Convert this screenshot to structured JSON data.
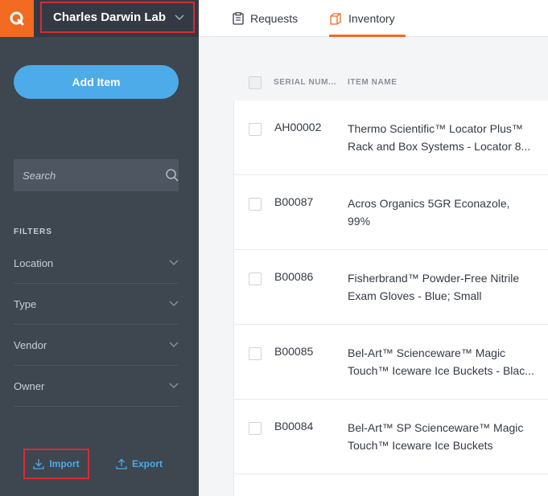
{
  "org": {
    "name": "Charles Darwin Lab"
  },
  "sidebar": {
    "add_item_label": "Add Item",
    "search_placeholder": "Search",
    "filters_title": "FILTERS",
    "filters": [
      {
        "label": "Location"
      },
      {
        "label": "Type"
      },
      {
        "label": "Vendor"
      },
      {
        "label": "Owner"
      }
    ],
    "import_label": "Import",
    "export_label": "Export"
  },
  "tabs": [
    {
      "label": "Requests",
      "icon": "clipboard-icon",
      "active": false
    },
    {
      "label": "Inventory",
      "icon": "box-icon",
      "active": true
    }
  ],
  "table": {
    "columns": [
      "SERIAL NUM...",
      "ITEM NAME"
    ],
    "rows": [
      {
        "serial": "AH00002",
        "name_line1": "Thermo Scientific™ Locator Plus™",
        "name_line2": "Rack and Box Systems - Locator 8..."
      },
      {
        "serial": "B00087",
        "name_line1": "Acros Organics 5GR Econazole,",
        "name_line2": "99%"
      },
      {
        "serial": "B00086",
        "name_line1": "Fisherbrand™ Powder-Free Nitrile",
        "name_line2": "Exam Gloves - Blue; Small"
      },
      {
        "serial": "B00085",
        "name_line1": "Bel-Art™ Scienceware™ Magic",
        "name_line2": "Touch™ Iceware Ice Buckets - Blac..."
      },
      {
        "serial": "B00084",
        "name_line1": "Bel-Art™ SP Scienceware™ Magic",
        "name_line2": "Touch™ Iceware Ice Buckets"
      }
    ]
  },
  "colors": {
    "brand_orange": "#f26b21",
    "accent_blue": "#4cabe8",
    "sidebar_bg": "#3e4650",
    "highlight_red": "#d92b32"
  }
}
